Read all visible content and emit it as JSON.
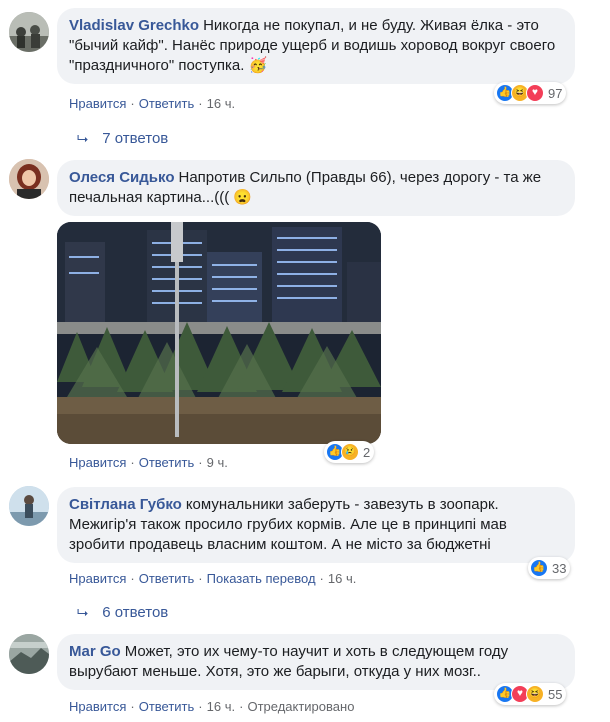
{
  "comments": [
    {
      "author": "Vladislav Grechko",
      "text": "Никогда не покупал, и не буду. Живая ёлка - это \"бычий кайф\". Нанёс природе ущерб и водишь хоровод вокруг своего \"праздничного\" поступка.",
      "emoji": "🥳",
      "like": "Нравится",
      "reply": "Ответить",
      "time": "16 ч.",
      "reaction_count": "97",
      "reaction_icons": [
        "like-icon",
        "haha-icon",
        "love-icon"
      ],
      "replies_label": "7 ответов"
    },
    {
      "author": "Олеся Сидько",
      "text": "Напротив Сильпо (Правды 66), через дорогу - та же печальная картина...(((",
      "emoji": "😦",
      "like": "Нравится",
      "reply": "Ответить",
      "time": "9 ч.",
      "reaction_count": "2",
      "reaction_icons": [
        "like-icon",
        "sad-icon"
      ]
    },
    {
      "author": "Світлана Губко",
      "text": "комунальники заберуть - завезуть в зоопарк. Межигір'я також просило грубих кормів. Але це в принципі мав зробити продавець власним коштом. А не місто за бюджетні",
      "like": "Нравится",
      "reply": "Ответить",
      "translate": "Показать перевод",
      "time": "16 ч.",
      "reaction_count": "33",
      "reaction_icons": [
        "like-icon"
      ],
      "replies_label": "6 ответов"
    },
    {
      "author": "Mar Go",
      "text": "Может, это их чему-то научит и хоть в следующем году вырубают меньше. Хотя, это же барыги, откуда у них мозг..",
      "like": "Нравится",
      "reply": "Ответить",
      "time": "16 ч.",
      "edited": "Отредактировано",
      "reaction_count": "55",
      "reaction_icons": [
        "like-icon",
        "love-icon",
        "haha-icon"
      ]
    }
  ],
  "separator": "·",
  "colors": {
    "link": "#385898",
    "bubble": "#f0f2f5",
    "meta": "#65676b",
    "like": "#1877f2",
    "love": "#f33e58",
    "haha": "#f7b125"
  }
}
